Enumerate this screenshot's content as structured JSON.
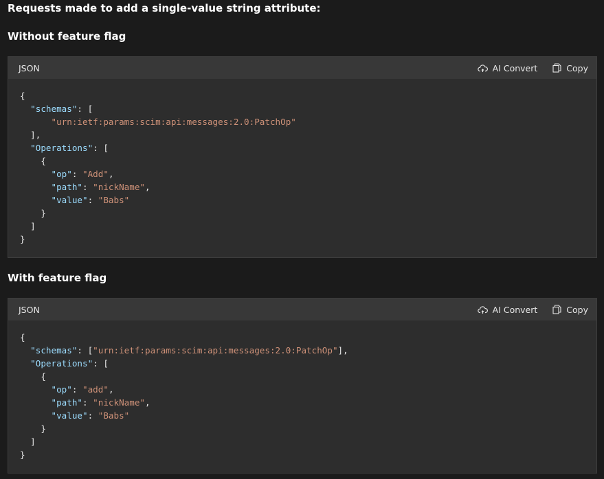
{
  "intro": "Requests made to add a single-value string attribute:",
  "section1": {
    "title": "Without feature flag",
    "lang": "JSON",
    "ai_convert": "AI Convert",
    "copy": "Copy",
    "code": {
      "open": "{",
      "schemas_key": "\"schemas\"",
      "schemas_open": ": [",
      "schemas_val": "\"urn:ietf:params:scim:api:messages:2.0:PatchOp\"",
      "schemas_close": "],",
      "ops_key": "\"Operations\"",
      "ops_open": ": [",
      "obj_open": "{",
      "op_key": "\"op\"",
      "op_val": "\"Add\"",
      "path_key": "\"path\"",
      "path_val": "\"nickName\"",
      "value_key": "\"value\"",
      "value_val": "\"Babs\"",
      "obj_close": "}",
      "ops_close": "]",
      "close": "}"
    }
  },
  "section2": {
    "title": "With feature flag",
    "lang": "JSON",
    "ai_convert": "AI Convert",
    "copy": "Copy",
    "code": {
      "open": "{",
      "schemas_key": "\"schemas\"",
      "schemas_val": "\"urn:ietf:params:scim:api:messages:2.0:PatchOp\"",
      "ops_key": "\"Operations\"",
      "ops_open": ": [",
      "obj_open": "{",
      "op_key": "\"op\"",
      "op_val": "\"add\"",
      "path_key": "\"path\"",
      "path_val": "\"nickName\"",
      "value_key": "\"value\"",
      "value_val": "\"Babs\"",
      "obj_close": "}",
      "ops_close": "]",
      "close": "}"
    }
  }
}
